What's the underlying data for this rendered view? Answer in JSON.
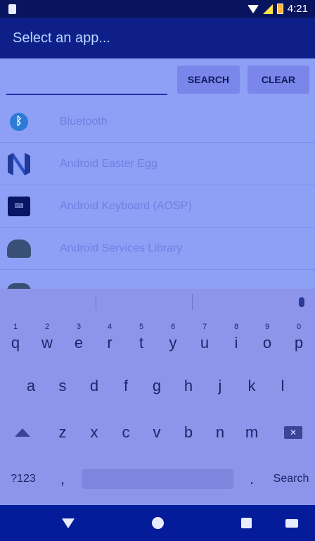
{
  "status_bar": {
    "time": "4:21",
    "icons": [
      "sim-card-icon",
      "wifi-icon",
      "cell-signal-icon",
      "battery-charging-icon"
    ]
  },
  "app_bar": {
    "title": "Select an app..."
  },
  "search": {
    "input_value": "",
    "placeholder": "",
    "search_label": "SEARCH",
    "clear_label": "CLEAR"
  },
  "apps": [
    {
      "icon": "bluetooth-icon",
      "label": "Bluetooth"
    },
    {
      "icon": "nougat-icon",
      "label": "Android Easter Egg"
    },
    {
      "icon": "keyboard-icon",
      "label": "Android Keyboard (AOSP)"
    },
    {
      "icon": "android-icon",
      "label": "Android Services Library"
    },
    {
      "icon": "android-icon",
      "label": ""
    }
  ],
  "keyboard": {
    "row1": [
      {
        "char": "q",
        "num": "1"
      },
      {
        "char": "w",
        "num": "2"
      },
      {
        "char": "e",
        "num": "3"
      },
      {
        "char": "r",
        "num": "4"
      },
      {
        "char": "t",
        "num": "5"
      },
      {
        "char": "y",
        "num": "6"
      },
      {
        "char": "u",
        "num": "7"
      },
      {
        "char": "i",
        "num": "8"
      },
      {
        "char": "o",
        "num": "9"
      },
      {
        "char": "p",
        "num": "0"
      }
    ],
    "row2": [
      "a",
      "s",
      "d",
      "f",
      "g",
      "h",
      "j",
      "k",
      "l"
    ],
    "row3": [
      "z",
      "x",
      "c",
      "v",
      "b",
      "n",
      "m"
    ],
    "symbols_label": "?123",
    "comma": ",",
    "period": ".",
    "action_label": "Search"
  },
  "nav_bar": {
    "icons": [
      "back-icon",
      "home-icon",
      "recents-icon",
      "keyboard-switch-icon"
    ]
  }
}
